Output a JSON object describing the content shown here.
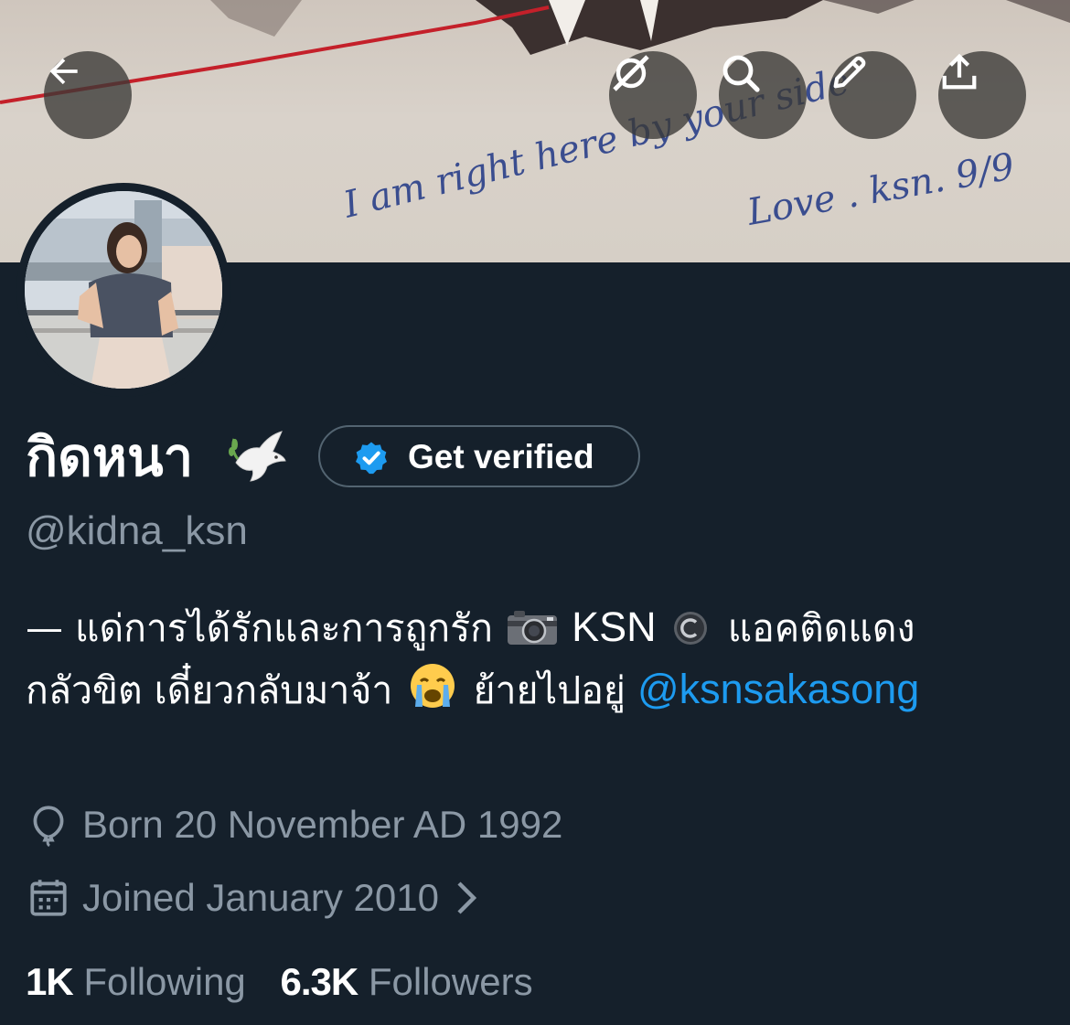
{
  "header": {
    "back_icon": "arrow-left-icon",
    "actions": [
      {
        "name": "grok-icon"
      },
      {
        "name": "search-icon"
      },
      {
        "name": "edit-icon"
      },
      {
        "name": "share-icon"
      }
    ]
  },
  "banner": {
    "handwriting_line1": "I am right here by your side",
    "handwriting_line2": "Love . ksn. 9/9"
  },
  "profile": {
    "display_name": "กิดหนา",
    "name_emoji": "dove-icon",
    "get_verified_label": "Get verified",
    "handle": "@kidna_ksn",
    "bio": {
      "line1_part1": "— แด่การได้รักและการถูกรัก",
      "line1_part2": "KSN",
      "line1_part3": "แอคติดแดง",
      "line2_part1": "กลัวขิต เดี๋ยวกลับมาจ้า",
      "line2_part2": "ย้ายไปอยู่",
      "mention": "@ksnsakasong"
    },
    "birthday": "Born 20 November AD 1992",
    "joined": "Joined January 2010"
  },
  "stats": {
    "following_count": "1K",
    "following_label": "Following",
    "followers_count": "6.3K",
    "followers_label": "Followers"
  },
  "colors": {
    "background": "#15202b",
    "secondary_text": "#8b98a5",
    "accent": "#1d9bf0",
    "border": "#536471"
  }
}
